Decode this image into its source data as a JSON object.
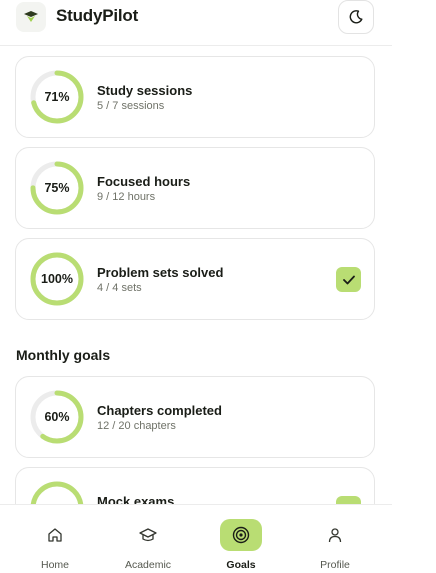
{
  "header": {
    "brand": "StudyPilot",
    "logo_icon": "graduation-cap-icon",
    "theme_icon": "moon-icon"
  },
  "colors": {
    "accent": "#b9dd73",
    "ring_track": "#ececec",
    "text_primary": "#1a1d17",
    "text_secondary": "#6f7268"
  },
  "weekly_goals": [
    {
      "percent_label": "71%",
      "progress": 0.71,
      "title": "Study sessions",
      "subtitle": "5 / 7 sessions",
      "completed": false
    },
    {
      "percent_label": "75%",
      "progress": 0.75,
      "title": "Focused hours",
      "subtitle": "9 / 12 hours",
      "completed": false
    },
    {
      "percent_label": "100%",
      "progress": 1.0,
      "title": "Problem sets solved",
      "subtitle": "4 / 4 sets",
      "completed": true
    }
  ],
  "monthly_section": {
    "title": "Monthly goals",
    "goals": [
      {
        "percent_label": "60%",
        "progress": 0.6,
        "title": "Chapters completed",
        "subtitle": "12 / 20 chapters",
        "completed": false
      },
      {
        "percent_label": "",
        "progress": 1.0,
        "title": "Mock exams",
        "subtitle": "",
        "completed": true
      }
    ]
  },
  "bottom_nav": {
    "items": [
      {
        "label": "Home",
        "icon": "home-icon",
        "active": false
      },
      {
        "label": "Academic",
        "icon": "graduation-cap-icon",
        "active": false
      },
      {
        "label": "Goals",
        "icon": "target-icon",
        "active": true
      },
      {
        "label": "Profile",
        "icon": "user-icon",
        "active": false
      }
    ]
  }
}
